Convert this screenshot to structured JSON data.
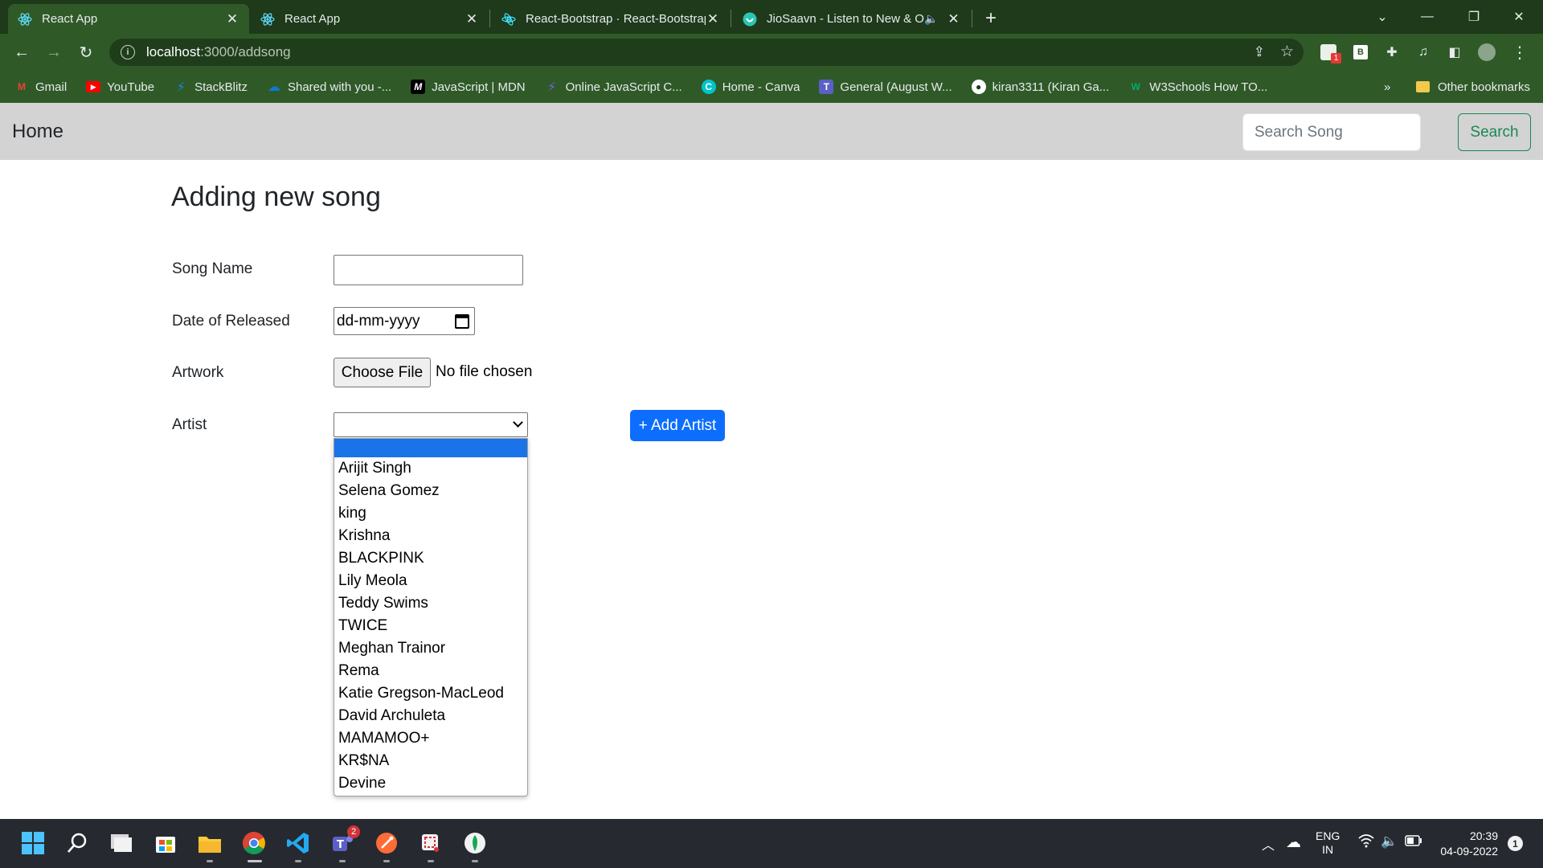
{
  "browser": {
    "tabs": [
      {
        "title": "React App",
        "icon": "react-icon",
        "active": true
      },
      {
        "title": "React App",
        "icon": "react-icon",
        "active": false
      },
      {
        "title": "React-Bootstrap · React-Bootstrap",
        "icon": "react-bootstrap-icon",
        "active": false
      },
      {
        "title": "JioSaavn - Listen to New & Old",
        "icon": "jiosaavn-icon",
        "active": false,
        "audio": true
      }
    ],
    "url_host": "localhost",
    "url_path": ":3000/addsong",
    "extension_badge": "1",
    "bookmarks": [
      {
        "label": "Gmail",
        "icon": "gmail-icon",
        "color": "#ea4335"
      },
      {
        "label": "YouTube",
        "icon": "youtube-icon",
        "color": "#ff0000"
      },
      {
        "label": "StackBlitz",
        "icon": "stackblitz-icon",
        "color": "#1389fd"
      },
      {
        "label": "Shared with you -...",
        "icon": "onedrive-icon",
        "color": "#0f78d4"
      },
      {
        "label": "JavaScript | MDN",
        "icon": "mdn-icon",
        "color": "#000000"
      },
      {
        "label": "Online JavaScript C...",
        "icon": "codepen-icon",
        "color": "#6c4cf0"
      },
      {
        "label": "Home - Canva",
        "icon": "canva-icon",
        "color": "#00c4cc"
      },
      {
        "label": "General (August W...",
        "icon": "teams-icon",
        "color": "#5b5fc7"
      },
      {
        "label": "kiran3311 (Kiran Ga...",
        "icon": "github-icon",
        "color": "#ffffff"
      },
      {
        "label": "W3Schools How TO...",
        "icon": "w3schools-icon",
        "color": "#04aa6d"
      }
    ],
    "bookmarks_more": "»",
    "other_bookmarks": "Other bookmarks"
  },
  "navbar": {
    "brand": "Home",
    "search_placeholder": "Search Song",
    "search_button": "Search"
  },
  "form": {
    "title": "Adding new song",
    "song_name_label": "Song Name",
    "date_label": "Date of Released",
    "date_placeholder": "dd-mm-yyyy",
    "artwork_label": "Artwork",
    "choose_file": "Choose File",
    "no_file": "No file chosen",
    "artist_label": "Artist",
    "add_artist_button": "+ Add Artist",
    "artist_options": [
      "",
      "Arijit Singh",
      "Selena Gomez",
      "king",
      "Krishna",
      "BLACKPINK",
      "Lily Meola",
      "Teddy Swims",
      "TWICE",
      "Meghan Trainor",
      "Rema",
      "Katie Gregson-MacLeod",
      "David Archuleta",
      "MAMAMOO+",
      "KR$NA",
      "Devine"
    ]
  },
  "taskbar": {
    "apps": [
      "windows-start-icon",
      "search-icon",
      "task-view-icon",
      "microsoft-store-icon",
      "file-explorer-icon",
      "chrome-icon",
      "vscode-icon",
      "teams-icon",
      "postman-icon",
      "snipping-tool-icon",
      "mongodb-compass-icon"
    ],
    "teams_badge": "2",
    "lang_line1": "ENG",
    "lang_line2": "IN",
    "time": "20:39",
    "date": "04-09-2022",
    "notification_count": "1"
  }
}
